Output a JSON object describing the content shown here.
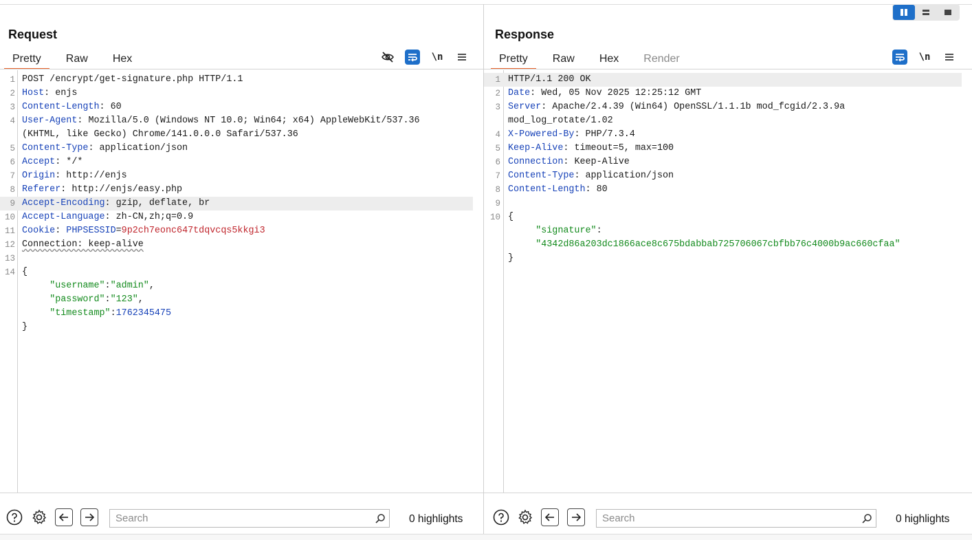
{
  "layout_buttons": [
    {
      "name": "split-horizontal",
      "active": true
    },
    {
      "name": "split-vertical",
      "active": false
    },
    {
      "name": "single",
      "active": false
    }
  ],
  "request": {
    "title": "Request",
    "tabs": [
      "Pretty",
      "Raw",
      "Hex"
    ],
    "active_tab": "Pretty",
    "lines": [
      {
        "n": "1",
        "parts": [
          {
            "t": "POST /encrypt/get-signature.php HTTP/1.1",
            "c": "v"
          }
        ]
      },
      {
        "n": "2",
        "parts": [
          {
            "t": "Host",
            "c": "k"
          },
          {
            "t": ": ",
            "c": "p"
          },
          {
            "t": "enjs",
            "c": "v"
          }
        ]
      },
      {
        "n": "3",
        "parts": [
          {
            "t": "Content-Length",
            "c": "k"
          },
          {
            "t": ": ",
            "c": "p"
          },
          {
            "t": "60",
            "c": "v"
          }
        ]
      },
      {
        "n": "4",
        "parts": [
          {
            "t": "User-Agent",
            "c": "k"
          },
          {
            "t": ": ",
            "c": "p"
          },
          {
            "t": "Mozilla/5.0 (Windows NT 10.0; Win64; x64) AppleWebKit/537.36",
            "c": "v"
          }
        ]
      },
      {
        "n": "",
        "parts": [
          {
            "t": "(KHTML, like Gecko) Chrome/141.0.0.0 Safari/537.36",
            "c": "v"
          }
        ]
      },
      {
        "n": "5",
        "parts": [
          {
            "t": "Content-Type",
            "c": "k"
          },
          {
            "t": ": ",
            "c": "p"
          },
          {
            "t": "application/json",
            "c": "v"
          }
        ]
      },
      {
        "n": "6",
        "parts": [
          {
            "t": "Accept",
            "c": "k"
          },
          {
            "t": ": ",
            "c": "p"
          },
          {
            "t": "*/*",
            "c": "v"
          }
        ]
      },
      {
        "n": "7",
        "parts": [
          {
            "t": "Origin",
            "c": "k"
          },
          {
            "t": ": ",
            "c": "p"
          },
          {
            "t": "http://enjs",
            "c": "v"
          }
        ]
      },
      {
        "n": "8",
        "parts": [
          {
            "t": "Referer",
            "c": "k"
          },
          {
            "t": ": ",
            "c": "p"
          },
          {
            "t": "http://enjs/easy.php",
            "c": "v"
          }
        ]
      },
      {
        "n": "9",
        "hl": true,
        "parts": [
          {
            "t": "Accept-Encoding",
            "c": "k"
          },
          {
            "t": ": ",
            "c": "p"
          },
          {
            "t": "gzip, deflate, br",
            "c": "v"
          }
        ]
      },
      {
        "n": "10",
        "parts": [
          {
            "t": "Accept-Language",
            "c": "k"
          },
          {
            "t": ": ",
            "c": "p"
          },
          {
            "t": "zh-CN,zh;q=0.9",
            "c": "v"
          }
        ]
      },
      {
        "n": "11",
        "parts": [
          {
            "t": "Cookie",
            "c": "k"
          },
          {
            "t": ": ",
            "c": "p"
          },
          {
            "t": "PHPSESSID",
            "c": "k"
          },
          {
            "t": "=",
            "c": "p"
          },
          {
            "t": "9p2ch7eonc647tdqvcqs5kkgi3",
            "c": "cookieval"
          }
        ]
      },
      {
        "n": "12",
        "parts": [
          {
            "t": "Connection: keep-alive",
            "c": "v squig"
          }
        ]
      },
      {
        "n": "13",
        "parts": []
      },
      {
        "n": "14",
        "parts": [
          {
            "t": "{",
            "c": "v"
          }
        ]
      },
      {
        "n": "",
        "parts": [
          {
            "t": "     ",
            "c": "p"
          },
          {
            "t": "\"username\"",
            "c": "str"
          },
          {
            "t": ":",
            "c": "p"
          },
          {
            "t": "\"admin\"",
            "c": "str"
          },
          {
            "t": ",",
            "c": "p"
          }
        ]
      },
      {
        "n": "",
        "parts": [
          {
            "t": "     ",
            "c": "p"
          },
          {
            "t": "\"password\"",
            "c": "str"
          },
          {
            "t": ":",
            "c": "p"
          },
          {
            "t": "\"123\"",
            "c": "str"
          },
          {
            "t": ",",
            "c": "p"
          }
        ]
      },
      {
        "n": "",
        "parts": [
          {
            "t": "     ",
            "c": "p"
          },
          {
            "t": "\"timestamp\"",
            "c": "str"
          },
          {
            "t": ":",
            "c": "p"
          },
          {
            "t": "1762345475",
            "c": "num"
          }
        ]
      },
      {
        "n": "",
        "parts": [
          {
            "t": "}",
            "c": "v"
          }
        ]
      }
    ],
    "search_placeholder": "Search",
    "highlights": "0 highlights"
  },
  "response": {
    "title": "Response",
    "tabs": [
      "Pretty",
      "Raw",
      "Hex",
      "Render"
    ],
    "active_tab": "Pretty",
    "lines": [
      {
        "n": "1",
        "hl": true,
        "parts": [
          {
            "t": "HTTP/1.1 200 OK",
            "c": "v"
          }
        ]
      },
      {
        "n": "2",
        "parts": [
          {
            "t": "Date",
            "c": "k"
          },
          {
            "t": ": ",
            "c": "p"
          },
          {
            "t": "Wed, 05 Nov 2025 12:25:12 GMT",
            "c": "v"
          }
        ]
      },
      {
        "n": "3",
        "parts": [
          {
            "t": "Server",
            "c": "k"
          },
          {
            "t": ": ",
            "c": "p"
          },
          {
            "t": "Apache/2.4.39 (Win64) OpenSSL/1.1.1b mod_fcgid/2.3.9a",
            "c": "v"
          }
        ]
      },
      {
        "n": "",
        "parts": [
          {
            "t": "mod_log_rotate/1.02",
            "c": "v"
          }
        ]
      },
      {
        "n": "4",
        "parts": [
          {
            "t": "X-Powered-By",
            "c": "k"
          },
          {
            "t": ": ",
            "c": "p"
          },
          {
            "t": "PHP/7.3.4",
            "c": "v"
          }
        ]
      },
      {
        "n": "5",
        "parts": [
          {
            "t": "Keep-Alive",
            "c": "k"
          },
          {
            "t": ": ",
            "c": "p"
          },
          {
            "t": "timeout=5, max=100",
            "c": "v"
          }
        ]
      },
      {
        "n": "6",
        "parts": [
          {
            "t": "Connection",
            "c": "k"
          },
          {
            "t": ": ",
            "c": "p"
          },
          {
            "t": "Keep-Alive",
            "c": "v"
          }
        ]
      },
      {
        "n": "7",
        "parts": [
          {
            "t": "Content-Type",
            "c": "k"
          },
          {
            "t": ": ",
            "c": "p"
          },
          {
            "t": "application/json",
            "c": "v"
          }
        ]
      },
      {
        "n": "8",
        "parts": [
          {
            "t": "Content-Length",
            "c": "k"
          },
          {
            "t": ": ",
            "c": "p"
          },
          {
            "t": "80",
            "c": "v"
          }
        ]
      },
      {
        "n": "9",
        "parts": []
      },
      {
        "n": "10",
        "parts": [
          {
            "t": "{",
            "c": "v"
          }
        ]
      },
      {
        "n": "",
        "parts": [
          {
            "t": "     ",
            "c": "p"
          },
          {
            "t": "\"signature\"",
            "c": "str"
          },
          {
            "t": ":",
            "c": "p"
          }
        ]
      },
      {
        "n": "",
        "parts": [
          {
            "t": "     ",
            "c": "p"
          },
          {
            "t": "\"4342d86a203dc1866ace8c675bdabbab725706067cbfbb76c4000b9ac660cfaa\"",
            "c": "str"
          }
        ]
      },
      {
        "n": "",
        "parts": [
          {
            "t": "}",
            "c": "v"
          }
        ]
      }
    ],
    "search_placeholder": "Search",
    "highlights": "0 highlights"
  },
  "icons": {
    "hide": "eye-slash-icon",
    "wrap": "word-wrap-icon",
    "newline": "\\n",
    "menu": "hamburger-menu-icon",
    "help": "help-icon",
    "settings": "gear-icon",
    "back": "arrow-left-icon",
    "forward": "arrow-right-icon",
    "search": "magnifier-icon"
  },
  "colors": {
    "accent": "#e8632a",
    "primary": "#1e6fc9",
    "header_key": "#1742b8",
    "cookie_value": "#c0262d",
    "json_string": "#128a1c"
  }
}
